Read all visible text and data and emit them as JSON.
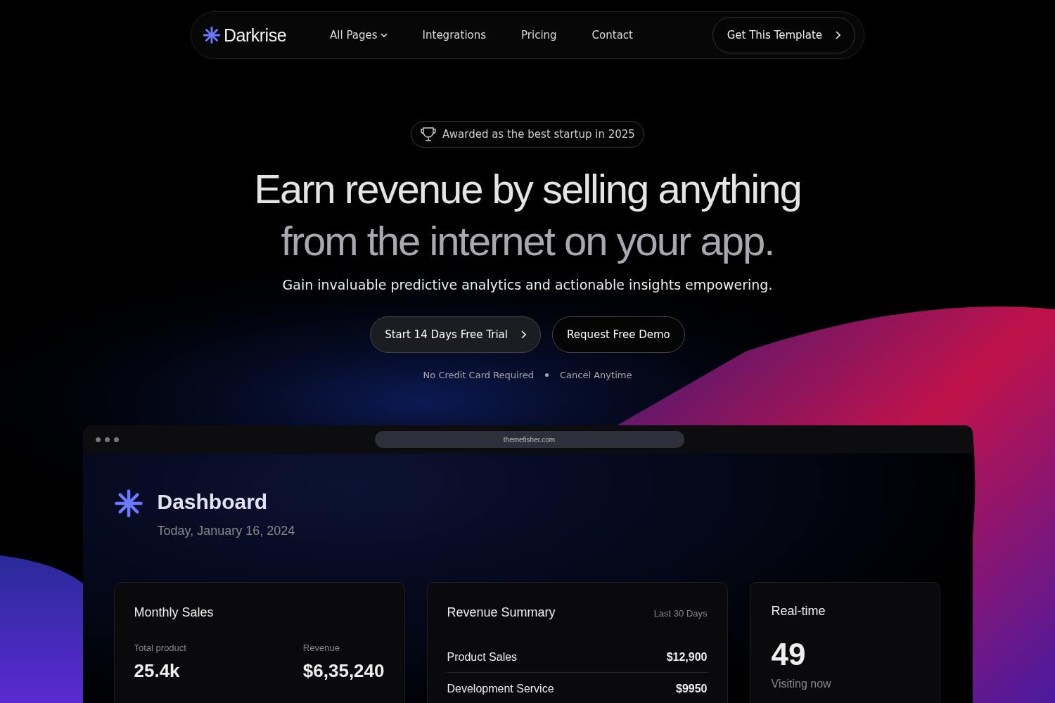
{
  "nav": {
    "logo": "Darkrise",
    "links": [
      {
        "label": "All Pages",
        "dropdown": true
      },
      {
        "label": "Integrations",
        "dropdown": false
      },
      {
        "label": "Pricing",
        "dropdown": false
      },
      {
        "label": "Contact",
        "dropdown": false
      }
    ],
    "cta": "Get This Template"
  },
  "hero": {
    "badge": "Awarded as the best startup in 2025",
    "headline": [
      "Earn revenue by selling anything",
      "from the internet on your app."
    ],
    "subtitle": "Gain invaluable predictive analytics and actionable insights empowering.",
    "buttons": [
      {
        "label": "Start 14 Days Free Trial",
        "kind": "primary"
      },
      {
        "label": "Request Free Demo",
        "kind": "secondary"
      }
    ],
    "notes": [
      "No Credit Card Required",
      "Cancel Anytime"
    ]
  },
  "browser": {
    "url": "themefisher.com"
  },
  "dashboard": {
    "title": "Dashboard",
    "date": "Today, January 16, 2024",
    "monthly_sales": {
      "title": "Monthly Sales",
      "stats": [
        {
          "label": "Total product",
          "value": "25.4k"
        },
        {
          "label": "Revenue",
          "value": "$6,35,240"
        }
      ]
    },
    "revenue_summary": {
      "title": "Revenue Summary",
      "period": "Last 30 Days",
      "rows": [
        {
          "label": "Product Sales",
          "value": "$12,900"
        },
        {
          "label": "Development Service",
          "value": "$9950"
        }
      ]
    },
    "realtime": {
      "title": "Real-time",
      "value": "49",
      "caption": "Visiting now"
    }
  }
}
